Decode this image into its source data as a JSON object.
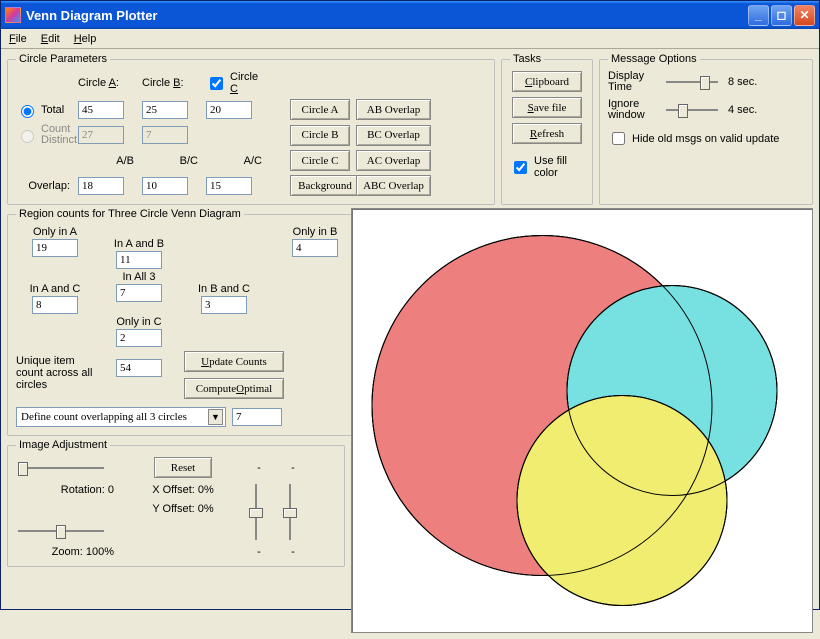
{
  "window": {
    "title": "Venn Diagram Plotter"
  },
  "menu": {
    "file": "File",
    "edit": "Edit",
    "help": "Help"
  },
  "circleParams": {
    "legend": "Circle Parameters",
    "circleA": "Circle A:",
    "circleB": "Circle B:",
    "circleC": "Circle C",
    "total": "Total",
    "countDistinct": "Count Distinct",
    "totalA": "45",
    "totalB": "25",
    "totalC": "20",
    "distA": "27",
    "distB": "7",
    "overlap": "Overlap:",
    "ab": "A/B",
    "bc": "B/C",
    "ac": "A/C",
    "ovAB": "18",
    "ovBC": "10",
    "ovAC": "15",
    "btnCircleA": "Circle A",
    "btnCircleB": "Circle B",
    "btnCircleC": "Circle C",
    "btnBackground": "Background",
    "btnABOverlap": "AB Overlap",
    "btnBCOverlap": "BC Overlap",
    "btnACOverlap": "AC Overlap",
    "btnABCOverlap": "ABC Overlap"
  },
  "tasks": {
    "legend": "Tasks",
    "clipboard": "Clipboard",
    "savefile": "Save file",
    "refresh": "Refresh",
    "usefill": "Use fill color"
  },
  "msgOpts": {
    "legend": "Message Options",
    "displayTime": "Display Time",
    "ignoreWindow": "Ignore window",
    "sec8": "8 sec.",
    "sec4": "4 sec.",
    "hideOld": "Hide old msgs on valid update"
  },
  "regions": {
    "legend": "Region counts for Three Circle Venn Diagram",
    "onlyA": "Only in A",
    "onlyA_v": "19",
    "inAB": "In A and B",
    "inAB_v": "11",
    "onlyB": "Only in B",
    "onlyB_v": "4",
    "inAC": "In A and C",
    "inAC_v": "8",
    "inAll3": "In All 3",
    "inAll3_v": "7",
    "inBC": "In B and C",
    "inBC_v": "3",
    "onlyC": "Only in C",
    "onlyC_v": "2",
    "unique": "Unique item count across all circles",
    "unique_v": "54",
    "updateCounts": "Update Counts",
    "computeOptimal": "Compute Optimal",
    "combo": "Define count overlapping all 3 circles",
    "comboVal": "7"
  },
  "imgAdj": {
    "legend": "Image Adjustment",
    "reset": "Reset",
    "rotation": "Rotation: 0",
    "xoffset": "X Offset: 0%",
    "yoffset": "Y Offset: 0%",
    "zoom": "Zoom: 100%",
    "dash": "-"
  },
  "chart_data": {
    "type": "venn3",
    "circles": [
      {
        "name": "A",
        "total": 45,
        "color": "#f8b4b4"
      },
      {
        "name": "B",
        "total": 25,
        "color": "#aaf0f0"
      },
      {
        "name": "C",
        "total": 20,
        "color": "#f8f6aa"
      }
    ],
    "regions": {
      "onlyA": 19,
      "onlyB": 4,
      "onlyC": 2,
      "A_and_B": 11,
      "A_and_C": 8,
      "B_and_C": 3,
      "A_B_C": 7
    },
    "overlap_inputs": {
      "AB": 18,
      "BC": 10,
      "AC": 15
    },
    "unique_total": 54
  }
}
